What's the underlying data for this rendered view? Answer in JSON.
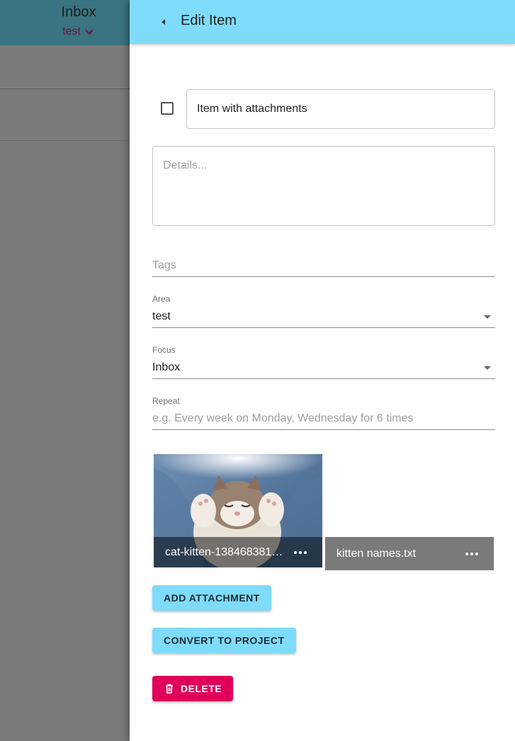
{
  "background": {
    "title": "Inbox",
    "subtitle": "test"
  },
  "drawer": {
    "title": "Edit Item",
    "item_title": "Item with attachments",
    "details_placeholder": "Details...",
    "tags_placeholder": "Tags",
    "area": {
      "label": "Area",
      "value": "test"
    },
    "focus": {
      "label": "Focus",
      "value": "Inbox"
    },
    "repeat": {
      "label": "Repeat",
      "placeholder": "e.g. Every week on Monday, Wednesday for 6 times"
    },
    "attachments": [
      {
        "name": "cat-kitten-138468381.j..."
      },
      {
        "name": "kitten names.txt"
      }
    ],
    "buttons": {
      "add_attachment": "Add Attachment",
      "convert_to_project": "Convert to Project",
      "delete": "Delete"
    }
  },
  "colors": {
    "accent": "#7fdbfa",
    "danger": "#e0005a"
  }
}
